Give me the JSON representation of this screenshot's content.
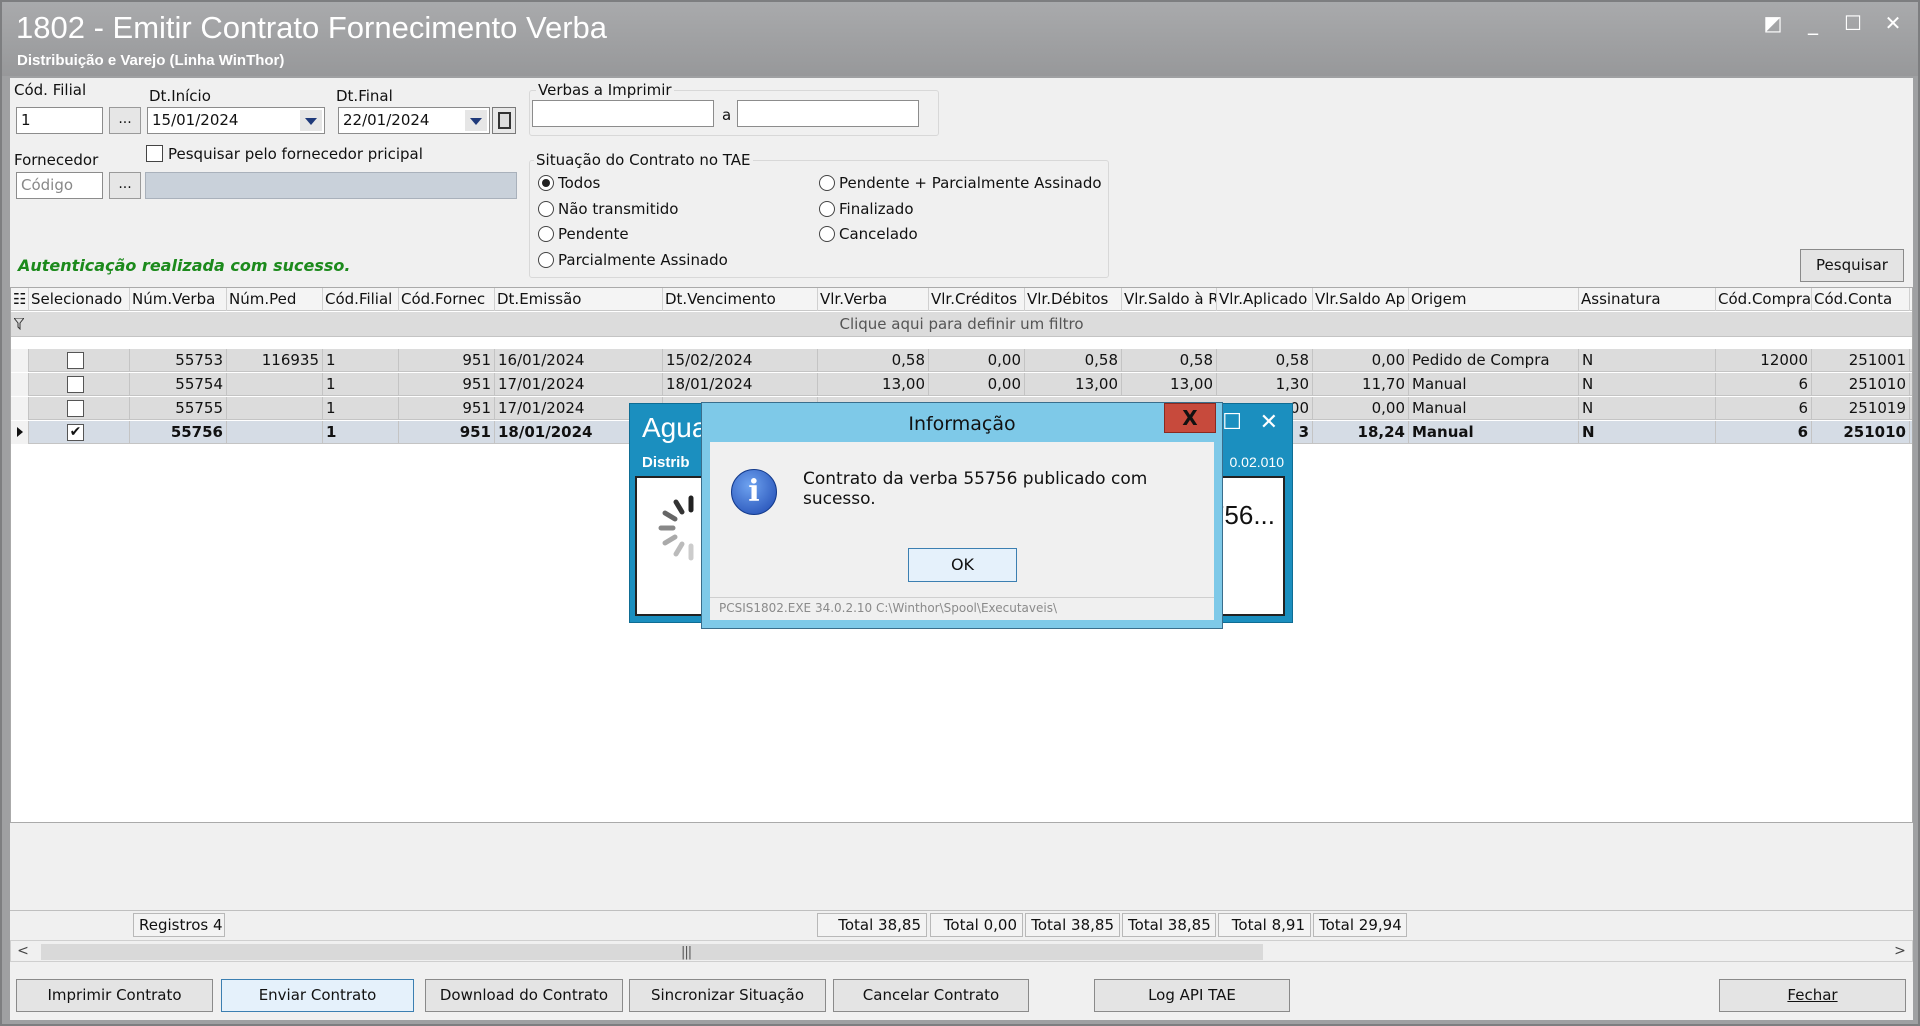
{
  "window": {
    "title": "1802 - Emitir Contrato Fornecimento Verba",
    "subtitle": "Distribuição e Varejo (Linha WinThor)",
    "controls": {
      "restore": "◩",
      "minimize": "_",
      "maximize": "☐",
      "close": "✕"
    }
  },
  "filters": {
    "cod_filial_label": "Cód. Filial",
    "cod_filial_value": "1",
    "dt_inicio_label": "Dt.Início",
    "dt_inicio_value": "15/01/2024",
    "dt_final_label": "Dt.Final",
    "dt_final_value": "22/01/2024",
    "verbas_label": "Verbas a Imprimir",
    "verbas_from": "",
    "verbas_to": "",
    "verbas_sep": "a",
    "fornecedor_label": "Fornecedor",
    "fornecedor_placeholder": "Código",
    "pesquisar_principal_label": "Pesquisar pelo fornecedor pricipal",
    "situacao_label": "Situação do Contrato no TAE",
    "situacao_options": [
      "Todos",
      "Não transmitido",
      "Pendente",
      "Parcialmente Assinado",
      "Pendente + Parcialmente Assinado",
      "Finalizado",
      "Cancelado"
    ],
    "situacao_selected": "Todos",
    "ellipsis": "..."
  },
  "status_message": "Autenticação realizada com sucesso.",
  "pesquisar_button": "Pesquisar",
  "grid": {
    "columns": [
      "Selecionado",
      "Núm.Verba",
      "Núm.Ped",
      "Cód.Filial",
      "Cód.Fornec",
      "Dt.Emissão",
      "Dt.Vencimento",
      "Vlr.Verba",
      "Vlr.Créditos",
      "Vlr.Débitos",
      "Vlr.Saldo à R",
      "Vlr.Aplicado",
      "Vlr.Saldo Ap",
      "Origem",
      "Assinatura",
      "Cód.Compra",
      "Cód.Conta"
    ],
    "filter_hint": "Clique aqui para definir um filtro",
    "rows": [
      {
        "sel": "",
        "num_verba": "55753",
        "num_ped": "116935",
        "cod_filial": "1",
        "cod_fornec": "951",
        "dt_emissao": "16/01/2024",
        "dt_venc": "15/02/2024",
        "vlr_verba": "0,58",
        "vlr_creditos": "0,00",
        "vlr_debitos": "0,58",
        "vlr_saldo_r": "0,58",
        "vlr_aplicado": "0,58",
        "vlr_saldo_ap": "0,00",
        "origem": "Pedido de Compra",
        "assinatura": "N",
        "cod_compra": "12000",
        "cod_conta": "251001"
      },
      {
        "sel": "",
        "num_verba": "55754",
        "num_ped": "",
        "cod_filial": "1",
        "cod_fornec": "951",
        "dt_emissao": "17/01/2024",
        "dt_venc": "18/01/2024",
        "vlr_verba": "13,00",
        "vlr_creditos": "0,00",
        "vlr_debitos": "13,00",
        "vlr_saldo_r": "13,00",
        "vlr_aplicado": "1,30",
        "vlr_saldo_ap": "11,70",
        "origem": "Manual",
        "assinatura": "N",
        "cod_compra": "6",
        "cod_conta": "251010"
      },
      {
        "sel": "",
        "num_verba": "55755",
        "num_ped": "",
        "cod_filial": "1",
        "cod_fornec": "951",
        "dt_emissao": "17/01/2024",
        "dt_venc": "",
        "vlr_verba": "",
        "vlr_creditos": "",
        "vlr_debitos": "",
        "vlr_saldo_r": "",
        "vlr_aplicado": "00",
        "vlr_saldo_ap": "0,00",
        "origem": "Manual",
        "assinatura": "N",
        "cod_compra": "6",
        "cod_conta": "251019"
      },
      {
        "sel": "✔",
        "num_verba": "55756",
        "num_ped": "",
        "cod_filial": "1",
        "cod_fornec": "951",
        "dt_emissao": "18/01/2024",
        "dt_venc": "",
        "vlr_verba": "",
        "vlr_creditos": "",
        "vlr_debitos": "",
        "vlr_saldo_r": "",
        "vlr_aplicado": "3",
        "vlr_saldo_ap": "18,24",
        "origem": "Manual",
        "assinatura": "N",
        "cod_compra": "6",
        "cod_conta": "251010"
      }
    ],
    "registros": "Registros 4",
    "totals": [
      "Total  38,85",
      "Total 0,00",
      "Total 38,85",
      "Total 38,85",
      "Total  8,91",
      "Total 29,94"
    ]
  },
  "buttons": {
    "imprimir": "Imprimir Contrato",
    "enviar": "Enviar Contrato",
    "download": "Download do Contrato",
    "sincronizar": "Sincronizar Situação",
    "cancelar": "Cancelar Contrato",
    "log": "Log API TAE",
    "fechar": "Fechar"
  },
  "aguarde": {
    "title": "Agua",
    "sub": "Distrib",
    "version": "0.02.010",
    "text": "756..."
  },
  "info_dialog": {
    "title": "Informação",
    "close": "X",
    "message": "Contrato da verba 55756 publicado com sucesso.",
    "ok": "OK",
    "status": "PCSIS1802.EXE 34.0.2.10 C:\\Winthor\\Spool\\Executaveis\\"
  },
  "colors": {
    "success": "#1c8a1c",
    "titlebar": "#a0a1a3",
    "dialog_frame": "#7ec9e8",
    "close_red": "#c74a3c",
    "aguarde_blue": "#1b8fbf"
  }
}
